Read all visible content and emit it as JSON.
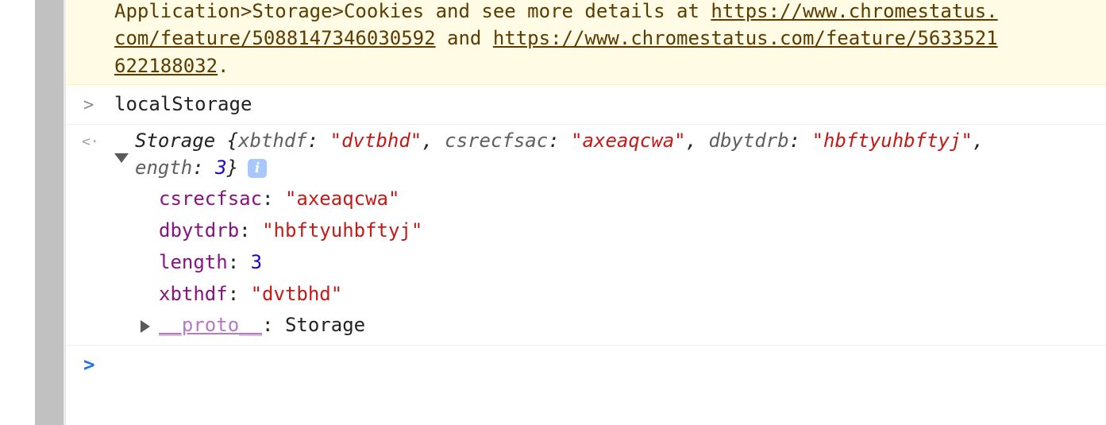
{
  "warning": {
    "line1_text": "Application>Storage>Cookies and see more details at ",
    "line1_link": "https://www.chromestatus.",
    "line2_link1": "com/feature/5088147346030592",
    "line2_mid": " and ",
    "line2_link2": "https://www.chromestatus.com/feature/5633521",
    "line3_link": "622188032",
    "line3_end": "."
  },
  "input": {
    "prompt_glyph": ">",
    "command": "localStorage"
  },
  "result": {
    "return_glyph": "<·",
    "summary": {
      "type_name": "Storage ",
      "open": "{",
      "entries": [
        {
          "key": "xbthdf",
          "value": "\"dvtbhd\""
        },
        {
          "key": "csrecfsac",
          "value": "\"axeaqcwa\""
        },
        {
          "key": "dbytdrb",
          "value": "\"hbftyuhbftyj\""
        }
      ],
      "sep": ": ",
      "comma": ", ",
      "trailing_comma": ",",
      "cont_key": "ength",
      "cont_value": "3",
      "close": "}",
      "info_glyph": "i"
    },
    "properties": [
      {
        "key": "csrecfsac",
        "value": "\"axeaqcwa\"",
        "kind": "string"
      },
      {
        "key": "dbytdrb",
        "value": "\"hbftyuhbftyj\"",
        "kind": "string"
      },
      {
        "key": "length",
        "value": "3",
        "kind": "number"
      },
      {
        "key": "xbthdf",
        "value": "\"dvtbhd\"",
        "kind": "string"
      }
    ],
    "proto": {
      "key": "__proto__",
      "sep": ": ",
      "value": "Storage"
    }
  },
  "prompt": {
    "glyph": ">"
  },
  "colors": {
    "warning_bg": "#fffbe5",
    "warning_text": "#5c3b00",
    "string": "#c41a16",
    "number": "#1c00cf",
    "property": "#881280",
    "proto": "#b679c4",
    "prompt": "#1a73e8"
  }
}
